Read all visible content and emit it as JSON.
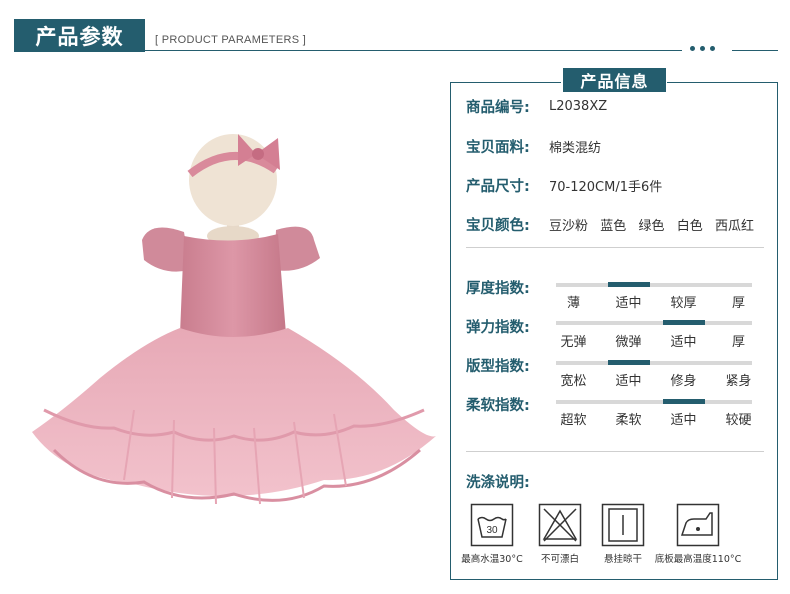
{
  "header": {
    "title": "产品参数",
    "subtitle": "[ PRODUCT PARAMETERS ]"
  },
  "panel": {
    "title": "产品信息",
    "info": [
      {
        "label": "商品编号:",
        "value": "L2038XZ"
      },
      {
        "label": "宝贝面料:",
        "value": "棉类混纺"
      },
      {
        "label": "产品尺寸:",
        "value": "70-120CM/1手6件"
      },
      {
        "label": "宝贝颜色:",
        "value": "豆沙粉  蓝色  绿色  白色  西瓜红"
      }
    ],
    "scales": [
      {
        "label": "厚度指数:",
        "options": [
          "薄",
          "适中",
          "较厚",
          "厚"
        ],
        "selected_index": 1
      },
      {
        "label": "弹力指数:",
        "options": [
          "无弹",
          "微弹",
          "适中",
          "厚"
        ],
        "selected_index": 2
      },
      {
        "label": "版型指数:",
        "options": [
          "宽松",
          "适中",
          "修身",
          "紧身"
        ],
        "selected_index": 1
      },
      {
        "label": "柔软指数:",
        "options": [
          "超软",
          "柔软",
          "适中",
          "较硬"
        ],
        "selected_index": 2
      }
    ],
    "wash": {
      "label": "洗涤说明:",
      "icons": [
        {
          "icon": "wash-30-icon",
          "temp": "30",
          "caption": "最高水温30°C"
        },
        {
          "icon": "no-bleach-icon",
          "caption": "不可漂白"
        },
        {
          "icon": "hang-dry-icon",
          "caption": "悬挂晾干"
        },
        {
          "icon": "iron-icon",
          "caption": "底板最高温度110°C"
        }
      ]
    }
  },
  "colors": {
    "accent": "#245d6e",
    "dress": "#d58f9f"
  }
}
